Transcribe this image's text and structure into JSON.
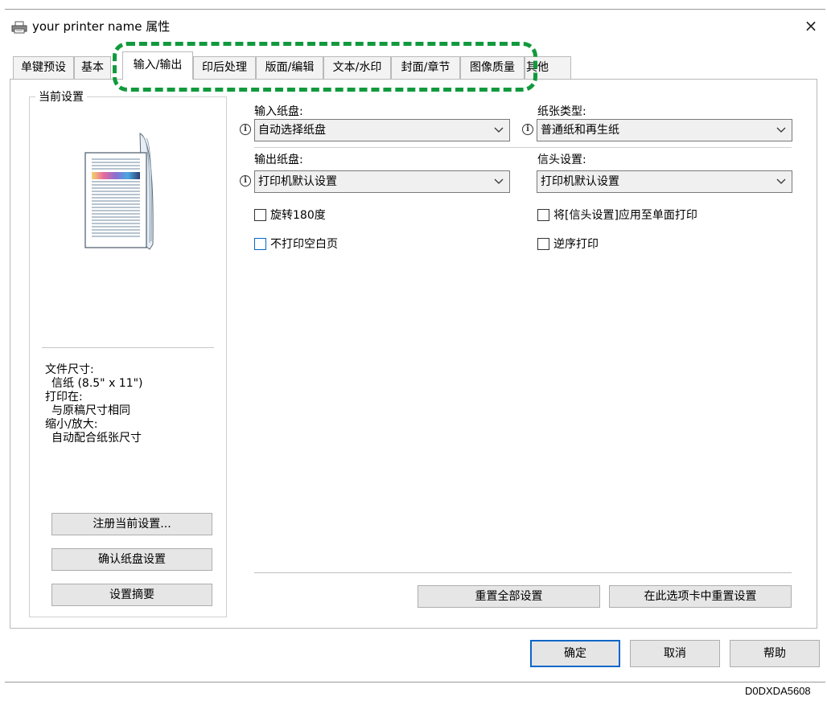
{
  "window": {
    "title": "your printer name 属性",
    "close_symbol": "×"
  },
  "tabs": [
    {
      "label": "单键预设"
    },
    {
      "label": "基本"
    },
    {
      "label": "输入/输出",
      "active": true
    },
    {
      "label": "印后处理"
    },
    {
      "label": "版面/编辑"
    },
    {
      "label": "文本/水印"
    },
    {
      "label": "封面/章节"
    },
    {
      "label": "图像质量"
    },
    {
      "label": "其他"
    }
  ],
  "current_settings": {
    "legend": "当前设置",
    "info": {
      "doc_size_label": "文件尺寸:",
      "doc_size_value": "信纸 (8.5\" x 11\")",
      "print_on_label": "打印在:",
      "print_on_value": "与原稿尺寸相同",
      "zoom_label": "缩小/放大:",
      "zoom_value": "自动配合纸张尺寸"
    },
    "buttons": {
      "register": "注册当前设置...",
      "confirm_tray": "确认纸盘设置",
      "summary": "设置摘要"
    }
  },
  "fields": {
    "input_tray": {
      "label": "输入纸盘:",
      "value": "自动选择纸盘"
    },
    "paper_type": {
      "label": "纸张类型:",
      "value": "普通纸和再生纸"
    },
    "output_tray": {
      "label": "输出纸盘:",
      "value": "打印机默认设置"
    },
    "letterhead": {
      "label": "信头设置:",
      "value": "打印机默认设置"
    }
  },
  "checkboxes": {
    "rotate180": {
      "label": "旋转180度",
      "checked": false
    },
    "apply_letterhead": {
      "label": "将[信头设置]应用至单面打印",
      "checked": false
    },
    "skip_blank": {
      "label": "不打印空白页",
      "checked": false
    },
    "reverse_order": {
      "label": "逆序打印",
      "checked": false
    }
  },
  "reset_buttons": {
    "reset_all": "重置全部设置",
    "reset_tab": "在此选项卡中重置设置"
  },
  "dialog_buttons": {
    "ok": "确定",
    "cancel": "取消",
    "help": "帮助"
  },
  "doc_code": "D0DXDA5608",
  "colors": {
    "highlight": "#119a3d",
    "focus": "#0a66c8"
  },
  "icons": {
    "title": "printer-icon",
    "info": "info-icon",
    "dropdown": "chevron-down-icon",
    "preview": "document-preview-icon"
  }
}
